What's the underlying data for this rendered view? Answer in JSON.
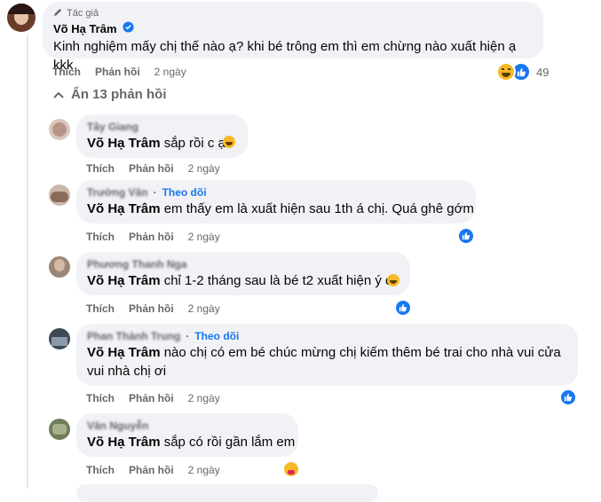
{
  "top_comment": {
    "author_badge": "Tác giả",
    "author": "Võ Hạ Trâm",
    "text": "Kinh nghiệm mấy chị thế nào ạ? khi bé trông em thì em chừng nào xuất hiện ạ kkk",
    "like": "Thích",
    "reply": "Phản hồi",
    "time": "2 ngày",
    "reaction_count": "49"
  },
  "hide_replies": "Ẩn 13 phản hồi",
  "replies": [
    {
      "name": "Tây Giang",
      "follow": "",
      "mention": "Võ Hạ Trâm",
      "text": " sắp rồi c ạ",
      "like": "Thích",
      "reply": "Phản hồi",
      "time": "2 ngày"
    },
    {
      "name": "Trường Văn",
      "follow": "Theo dõi",
      "mention": "Võ Hạ Trâm",
      "text": " em thấy em là xuất hiện sau 1th á chị. Quá ghê gớm",
      "like": "Thích",
      "reply": "Phản hồi",
      "time": "2 ngày"
    },
    {
      "name": "Phương Thanh Nga",
      "follow": "",
      "mention": "Võ Hạ Trâm",
      "text": " chỉ 1-2 tháng sau là bé t2 xuất hiện ý c",
      "like": "Thích",
      "reply": "Phản hồi",
      "time": "2 ngày"
    },
    {
      "name": "Phan Thành Trung",
      "follow": "Theo dõi",
      "mention": "Võ Hạ Trâm",
      "text": " nào chị có em bé chúc mừng chị kiếm thêm bé trai cho nhà vui cửa vui nhà chị ơi",
      "like": "Thích",
      "reply": "Phản hồi",
      "time": "2 ngày"
    },
    {
      "name": "Văn Nguyễn",
      "follow": "",
      "mention": "Võ Hạ Trâm",
      "text": " sắp có rồi gần lắm em",
      "like": "Thích",
      "reply": "Phản hồi",
      "time": "2 ngày"
    }
  ],
  "colors": {
    "bubble": "#f0f2f5",
    "muted": "#65676b",
    "link": "#1877f2",
    "like": "#1877f2",
    "haha": "#f7b928"
  },
  "icons": {
    "author_badge": "pencil-icon",
    "verified": "verified-badge-icon",
    "hide": "chevron-up-icon",
    "like_reaction": "thumbs-up-icon",
    "haha_reaction": "haha-emoji-icon",
    "care_reaction": "care-emoji-icon"
  }
}
